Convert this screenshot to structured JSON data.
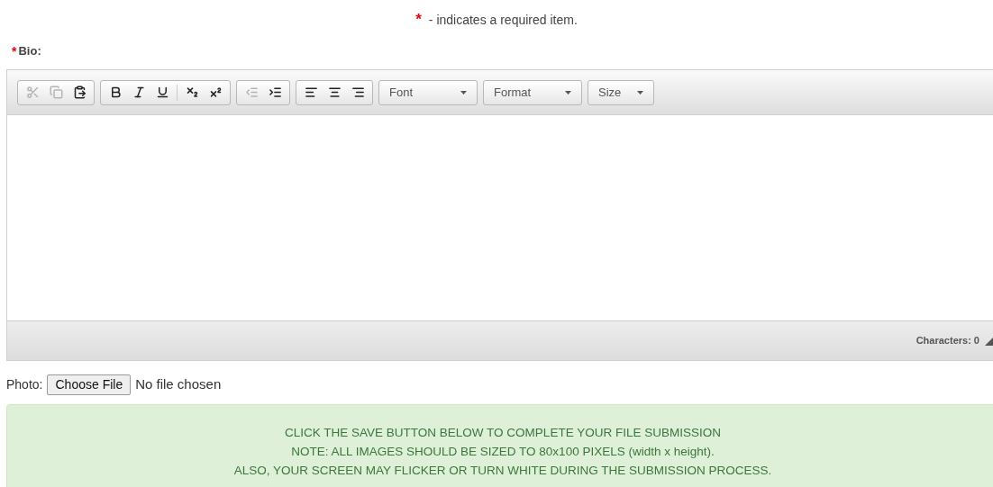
{
  "required_note": {
    "mark": "*",
    "text": "- indicates a required item."
  },
  "bio": {
    "mark": "*",
    "label": "Bio:"
  },
  "editor": {
    "toolbar": [
      {
        "sections": [
          {
            "items": [
              {
                "kind": "cut",
                "disabled": true
              },
              {
                "kind": "copy",
                "disabled": true
              },
              {
                "kind": "paste",
                "disabled": false
              }
            ]
          }
        ]
      },
      {
        "sections": [
          {
            "items": [
              {
                "kind": "bold",
                "disabled": false
              },
              {
                "kind": "italic",
                "disabled": false
              },
              {
                "kind": "underline",
                "disabled": false
              }
            ]
          },
          {
            "items": [
              {
                "kind": "subscript",
                "disabled": false
              },
              {
                "kind": "superscript",
                "disabled": false
              }
            ]
          }
        ]
      },
      {
        "sections": [
          {
            "items": [
              {
                "kind": "outdent",
                "disabled": true
              },
              {
                "kind": "indent",
                "disabled": false
              }
            ]
          }
        ]
      },
      {
        "sections": [
          {
            "items": [
              {
                "kind": "align-left",
                "disabled": false
              },
              {
                "kind": "align-center",
                "disabled": false
              },
              {
                "kind": "align-right",
                "disabled": false
              }
            ]
          }
        ]
      }
    ],
    "dropdowns": [
      {
        "label": "Font"
      },
      {
        "label": "Format"
      },
      {
        "label": "Size"
      }
    ],
    "character_count": "Characters: 0"
  },
  "photo": {
    "label": "Photo:",
    "button": "Choose File",
    "status": "No file chosen"
  },
  "notice": [
    "CLICK THE SAVE BUTTON BELOW TO COMPLETE YOUR FILE SUBMISSION",
    "NOTE: ALL IMAGES SHOULD BE SIZED TO 80x100 PIXELS (width x height).",
    "ALSO, YOUR SCREEN MAY FLICKER OR TURN WHITE DURING THE SUBMISSION PROCESS."
  ]
}
